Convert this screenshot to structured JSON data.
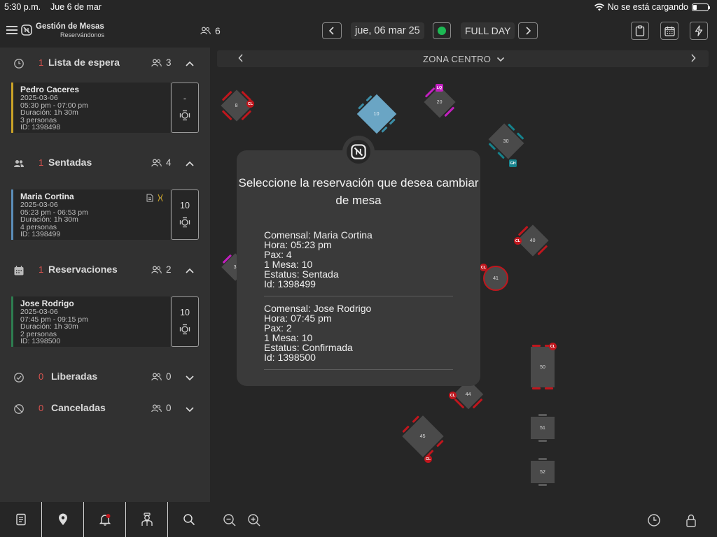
{
  "status_bar": {
    "time": "5:30 p.m.",
    "date": "Jue 6 de mar",
    "battery_text": "No se está cargando"
  },
  "header": {
    "brand_title": "Gestión de Mesas",
    "brand_subtitle": "Reservándonos",
    "guest_count": "6",
    "date": "jue, 06 mar 25",
    "shift": "FULL DAY",
    "status_color": "#1db954"
  },
  "sections": {
    "waitlist": {
      "count": "1",
      "title": "Lista de espera",
      "pax": "3",
      "card": {
        "name": "Pedro Caceres",
        "date": "2025-03-06",
        "time": "05:30 pm - 07:00 pm",
        "duration": "Duración: 1h 30m",
        "people": "3 personas",
        "id": "ID: 1398498",
        "table": "-",
        "accent": "#c9a227"
      }
    },
    "seated": {
      "count": "1",
      "title": "Sentadas",
      "pax": "4",
      "card": {
        "name": "Maria Cortina",
        "date": "2025-03-06",
        "time": "05:23 pm - 06:53 pm",
        "duration": "Duración: 1h 30m",
        "people": "4 personas",
        "id": "ID: 1398499",
        "table": "10",
        "accent": "#5b8db8"
      }
    },
    "reservations": {
      "count": "1",
      "title": "Reservaciones",
      "pax": "2",
      "card": {
        "name": "Jose Rodrigo",
        "date": "2025-03-06",
        "time": "07:45 pm - 09:15 pm",
        "duration": "Duración: 1h 30m",
        "people": "2 personas",
        "id": "ID: 1398500",
        "table": "10",
        "accent": "#2e7d4f"
      }
    },
    "released": {
      "count": "0",
      "title": "Liberadas",
      "pax": "0"
    },
    "cancelled": {
      "count": "0",
      "title": "Canceladas",
      "pax": "0"
    }
  },
  "map": {
    "zone": "ZONA CENTRO",
    "tables": [
      {
        "num": "8",
        "pax": "0",
        "badge": "CL"
      },
      {
        "num": "10",
        "pax": "0"
      },
      {
        "num": "20",
        "pax": "0",
        "badge": "LQ"
      },
      {
        "num": "30",
        "pax": "0",
        "badge": "GH"
      },
      {
        "num": "40",
        "pax": "0",
        "badge": "CL"
      },
      {
        "num": "41",
        "pax": "0",
        "badge": "CL"
      },
      {
        "num": "44",
        "pax": "0",
        "badge": "CL"
      },
      {
        "num": "45",
        "pax": "0",
        "badge": "CL"
      },
      {
        "num": "50",
        "pax": "0",
        "badge": "CL"
      },
      {
        "num": "51",
        "pax": "0"
      },
      {
        "num": "52",
        "pax": "0"
      },
      {
        "num": "3"
      }
    ]
  },
  "modal": {
    "title": "Seleccione la reservación que desea cambiar de mesa",
    "entries": [
      {
        "comensal": "Comensal: Maria Cortina",
        "hora": "Hora: 05:23 pm",
        "pax": "Pax: 4",
        "mesa": "1 Mesa: 10",
        "estatus": "Estatus: Sentada",
        "id": "Id: 1398499"
      },
      {
        "comensal": "Comensal: Jose Rodrigo",
        "hora": "Hora: 07:45 pm",
        "pax": "Pax: 2",
        "mesa": "1 Mesa: 10",
        "estatus": "Estatus: Confirmada",
        "id": "Id: 1398500"
      }
    ]
  }
}
